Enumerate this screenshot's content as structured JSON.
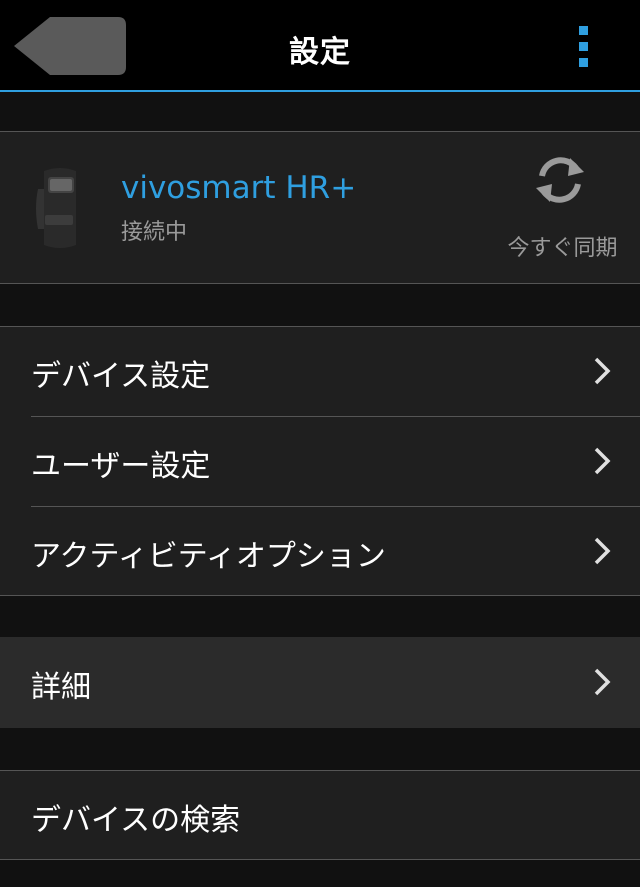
{
  "header": {
    "title": "設定",
    "back_icon": "back-arrow-icon",
    "more_icon": "more-vertical-icon"
  },
  "colors": {
    "accent": "#2f9fe0",
    "background": "#111111",
    "card": "#1f1f1f",
    "highlight_row": "#2b2b2b",
    "secondary_text": "#9a9a9a"
  },
  "device": {
    "name": "vivosmart HR+",
    "status": "接続中",
    "image_icon": "smart-band-icon",
    "sync_icon": "sync-icon",
    "sync_label": "今すぐ同期"
  },
  "menu": {
    "group1": [
      {
        "label": "デバイス設定",
        "icon": "chevron-right-icon"
      },
      {
        "label": "ユーザー設定",
        "icon": "chevron-right-icon"
      },
      {
        "label": "アクティビティオプション",
        "icon": "chevron-right-icon"
      }
    ],
    "group2": [
      {
        "label": "詳細",
        "icon": "chevron-right-icon"
      }
    ],
    "group3": [
      {
        "label": "デバイスの検索"
      }
    ]
  }
}
